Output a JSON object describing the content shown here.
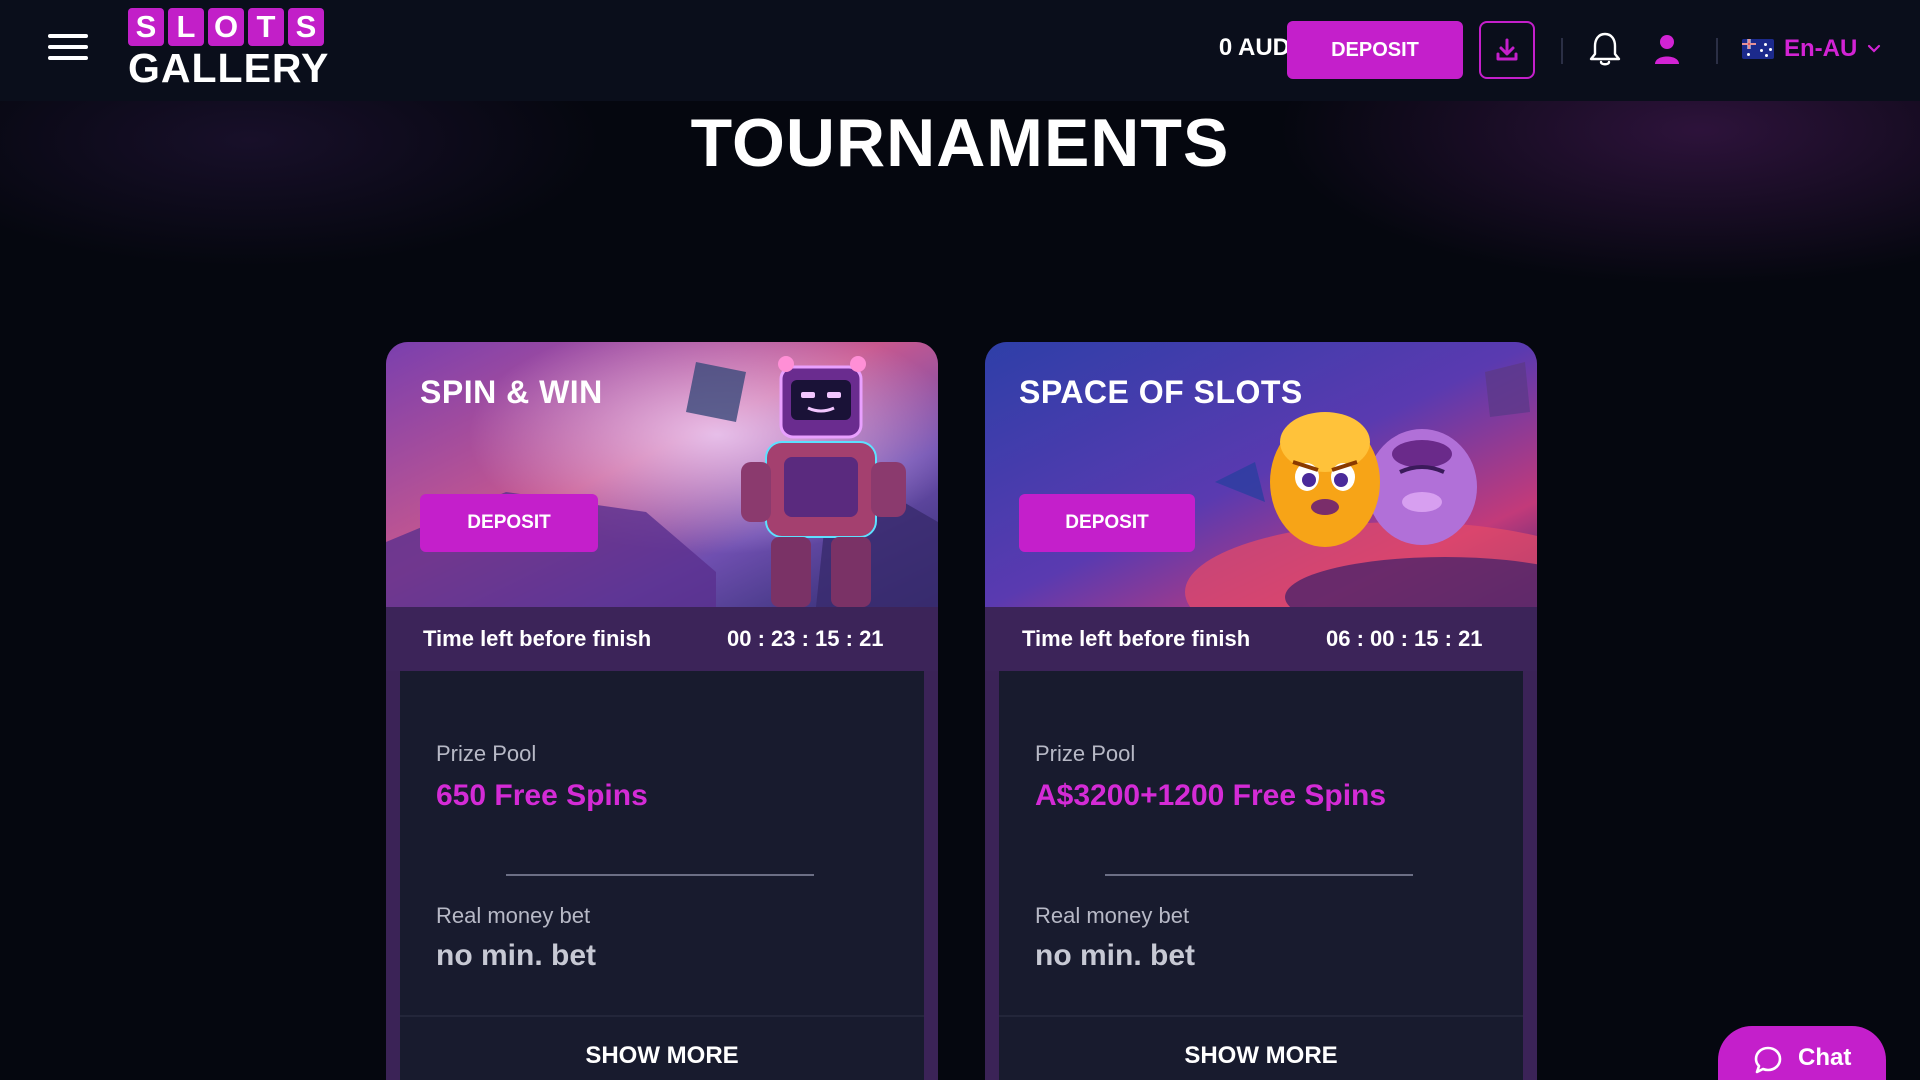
{
  "header": {
    "logo_top": [
      "S",
      "L",
      "O",
      "T",
      "S"
    ],
    "logo_bottom": "GALLERY",
    "balance": "0 AUD",
    "deposit_label": "DEPOSIT",
    "language": "En-AU",
    "menu_icon": "hamburger-menu-icon",
    "download_icon": "download-icon",
    "bell_icon": "bell-icon",
    "user_icon": "user-icon",
    "flag_icon": "australia-flag-icon"
  },
  "page": {
    "title": "TOURNAMENTS"
  },
  "tournaments": [
    {
      "title": "SPIN & WIN",
      "deposit_label": "DEPOSIT",
      "timer_label": "Time left before finish",
      "timer_value": "00 : 23 : 15 : 21",
      "prize_label": "Prize Pool",
      "prize_value": "650 Free Spins",
      "bet_label": "Real money bet",
      "bet_value": "no min. bet",
      "show_more": "SHOW MORE"
    },
    {
      "title": "SPACE OF SLOTS",
      "deposit_label": "DEPOSIT",
      "timer_label": "Time left before finish",
      "timer_value": "06 : 00 : 15 : 21",
      "prize_label": "Prize Pool",
      "prize_value": "A$3200+1200 Free Spins",
      "bet_label": "Real money bet",
      "bet_value": "no min. bet",
      "show_more": "SHOW MORE"
    }
  ],
  "chat": {
    "label": "Chat",
    "icon": "chat-bubble-icon"
  },
  "colors": {
    "accent": "#c41fcb",
    "accent_text": "#d42bd6",
    "header_bg": "#0a0e1b",
    "card_body_bg": "#181b2e",
    "card_frame_bg": "#3c2459"
  }
}
